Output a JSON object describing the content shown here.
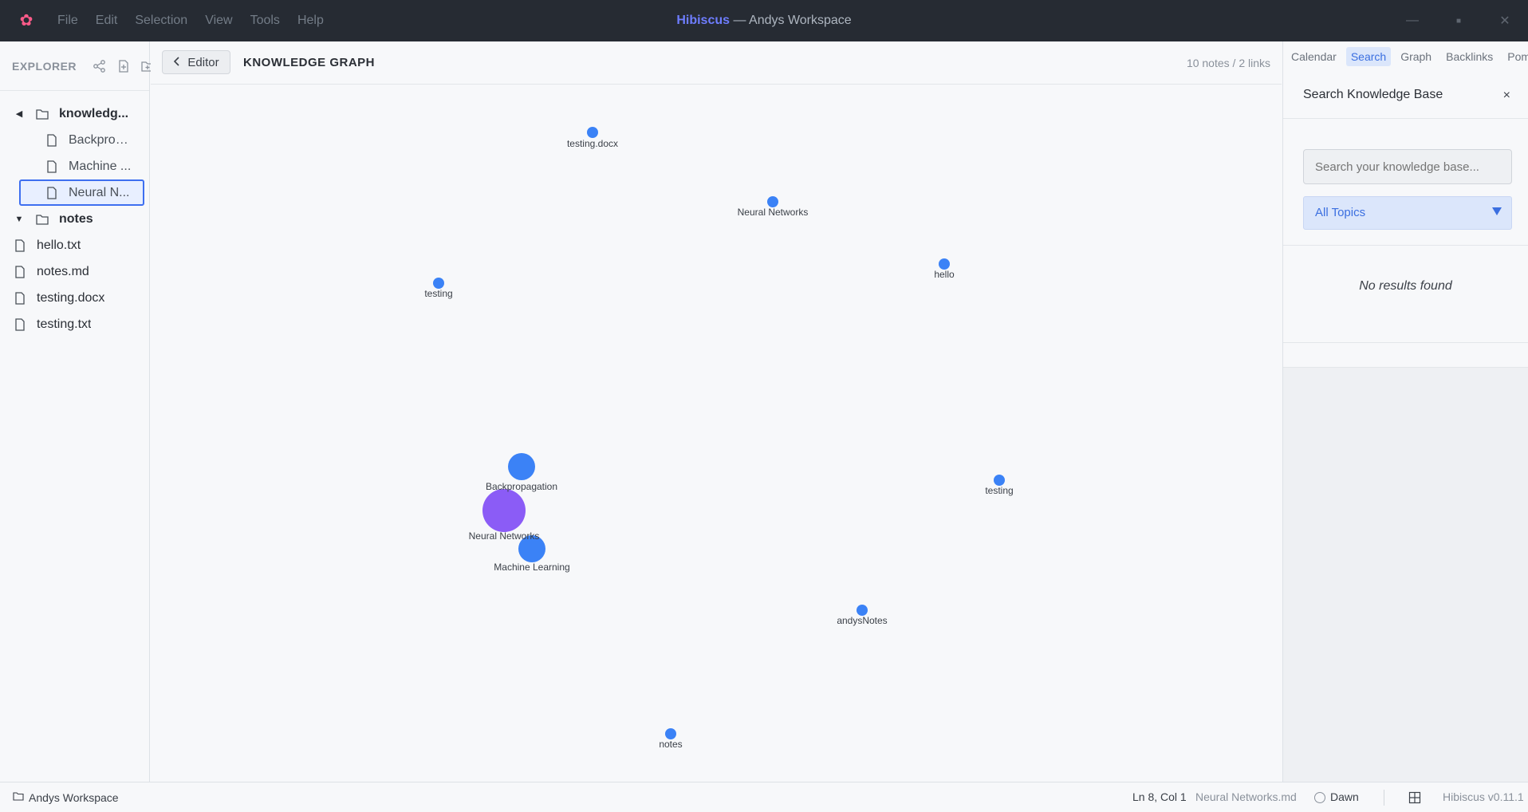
{
  "titlebar": {
    "logo": "✿",
    "brand": "Hibiscus",
    "workspace": " — Andys Workspace",
    "menu": [
      "File",
      "Edit",
      "Selection",
      "View",
      "Tools",
      "Help"
    ],
    "controls": {
      "minimize": "—",
      "maximize": "■",
      "close": "✕"
    }
  },
  "explorer": {
    "label": "EXPLORER",
    "tree": [
      {
        "label": "knowledg...",
        "kind": "folder",
        "expanded": true,
        "depth": 0,
        "arrow": "◀"
      },
      {
        "label": "Backprop...",
        "kind": "file",
        "depth": 1
      },
      {
        "label": "Machine ...",
        "kind": "file",
        "depth": 1
      },
      {
        "label": "Neural N...",
        "kind": "file",
        "depth": 1,
        "selected": true
      },
      {
        "label": "notes",
        "kind": "folder",
        "expanded": true,
        "depth": 0,
        "arrow": "▼"
      },
      {
        "label": "hello.txt",
        "kind": "file",
        "depth": 0
      },
      {
        "label": "notes.md",
        "kind": "file",
        "depth": 0
      },
      {
        "label": "testing.docx",
        "kind": "file",
        "depth": 0
      },
      {
        "label": "testing.txt",
        "kind": "file",
        "depth": 0
      }
    ]
  },
  "graph_header": {
    "editor_button": "Editor",
    "title": "KNOWLEDGE GRAPH",
    "stats": "10 notes / 2 links"
  },
  "graph": {
    "node_color": "#3b82f6",
    "active_color": "#8b5cf6",
    "nodes": [
      {
        "label": "testing.docx"
      },
      {
        "label": "Neural Networks"
      },
      {
        "label": "hello"
      },
      {
        "label": "testing"
      },
      {
        "label": "Backpropagation"
      },
      {
        "label": "Neural Networks",
        "active": true
      },
      {
        "label": "Machine Learning"
      },
      {
        "label": "testing"
      },
      {
        "label": "andysNotes"
      },
      {
        "label": "notes"
      }
    ]
  },
  "right_panel": {
    "tabs": [
      "Calendar",
      "Search",
      "Graph",
      "Backlinks",
      "Pomo"
    ],
    "active_tab": "Search",
    "search": {
      "title": "Search Knowledge Base",
      "close": "×",
      "placeholder": "Search your knowledge base...",
      "topic": "All Topics",
      "empty": "No results found"
    }
  },
  "status": {
    "workspace": "Andys Workspace",
    "position": "Ln 8, Col 1",
    "file": "Neural Networks.md",
    "theme": "Dawn",
    "version": "Hibiscus v0.11.1"
  }
}
